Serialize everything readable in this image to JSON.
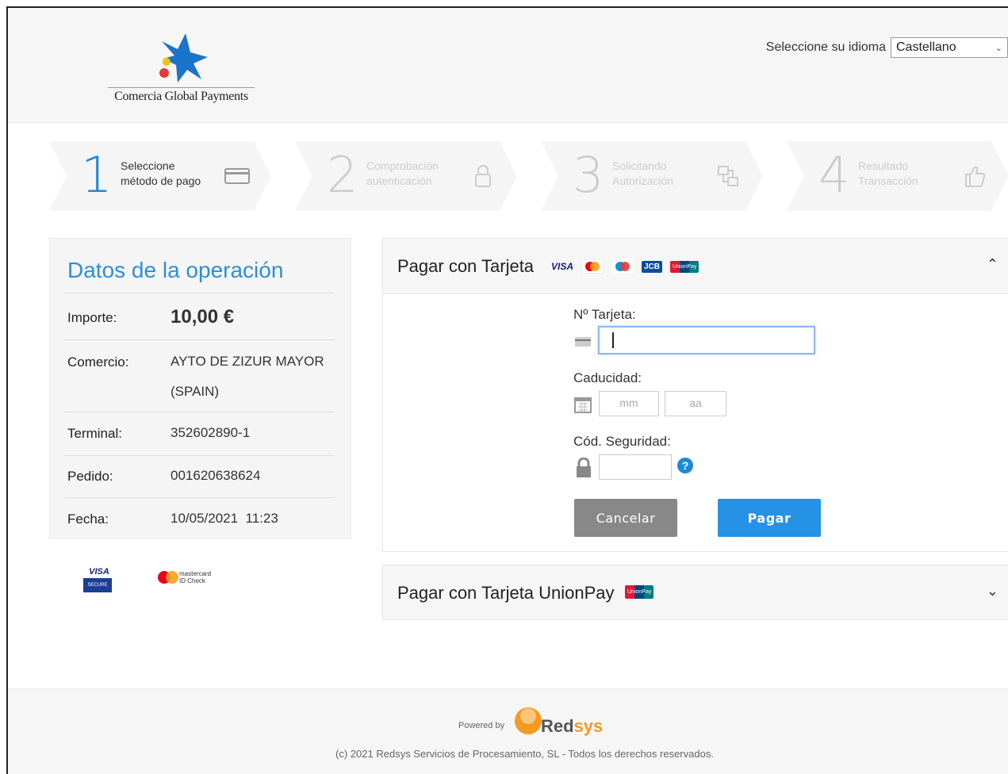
{
  "header": {
    "brand_text": "Comercia Global Payments",
    "language_label": "Seleccione su idioma",
    "language_value": "Castellano"
  },
  "steps": [
    {
      "number": "1",
      "line1": "Seleccione",
      "line2": "método de pago",
      "icon": "credit-card-icon",
      "active": true
    },
    {
      "number": "2",
      "line1": "Comprobación",
      "line2": "autenticación",
      "icon": "lock-icon",
      "active": false
    },
    {
      "number": "3",
      "line1": "Solicitando",
      "line2": "Autorización",
      "icon": "transfer-icon",
      "active": false
    },
    {
      "number": "4",
      "line1": "Resultado",
      "line2": "Transacción",
      "icon": "thumbs-up-icon",
      "active": false
    }
  ],
  "operation": {
    "title": "Datos de la operación",
    "rows": [
      {
        "label": "Importe:",
        "value": "10,00 €"
      },
      {
        "label": "Comercio:",
        "value_line1": "AYTO DE ZIZUR MAYOR",
        "value_line2": "(SPAIN)"
      },
      {
        "label": "Terminal:",
        "value": "352602890-1"
      },
      {
        "label": "Pedido:",
        "value": "001620638624"
      },
      {
        "label": "Fecha:",
        "value": "10/05/2021  11:23"
      }
    ]
  },
  "badges": {
    "visa_top": "VISA",
    "visa_bottom": "SECURE",
    "mc_line1": "mastercard",
    "mc_line2": "ID Check"
  },
  "card_form": {
    "title": "Pagar con Tarjeta",
    "card_logos": {
      "visa": "VISA",
      "jcb": "JCB",
      "unionpay": "UnionPay"
    },
    "card_number_label": "Nº Tarjeta:",
    "card_number_value": "",
    "expiry_label": "Caducidad:",
    "month_placeholder": "mm",
    "year_placeholder": "aa",
    "cvv_label": "Cód. Seguridad:",
    "help_glyph": "?",
    "cancel_label": "Cancelar",
    "pay_label": "Pagar",
    "expanded": true
  },
  "unionpay_form": {
    "title": "Pagar con Tarjeta UnionPay",
    "expanded": false
  },
  "footer": {
    "powered_by": "Powered by",
    "brand_main": "Red",
    "brand_accent": "sys",
    "copyright": "(c) 2021 Redsys Servicios de Procesamiento, SL - Todos los derechos reservados."
  },
  "colors": {
    "accent_blue": "#2592e6",
    "title_blue": "#2c8fd8",
    "cancel_gray": "#888888",
    "redsys_orange": "#f39a1f"
  }
}
